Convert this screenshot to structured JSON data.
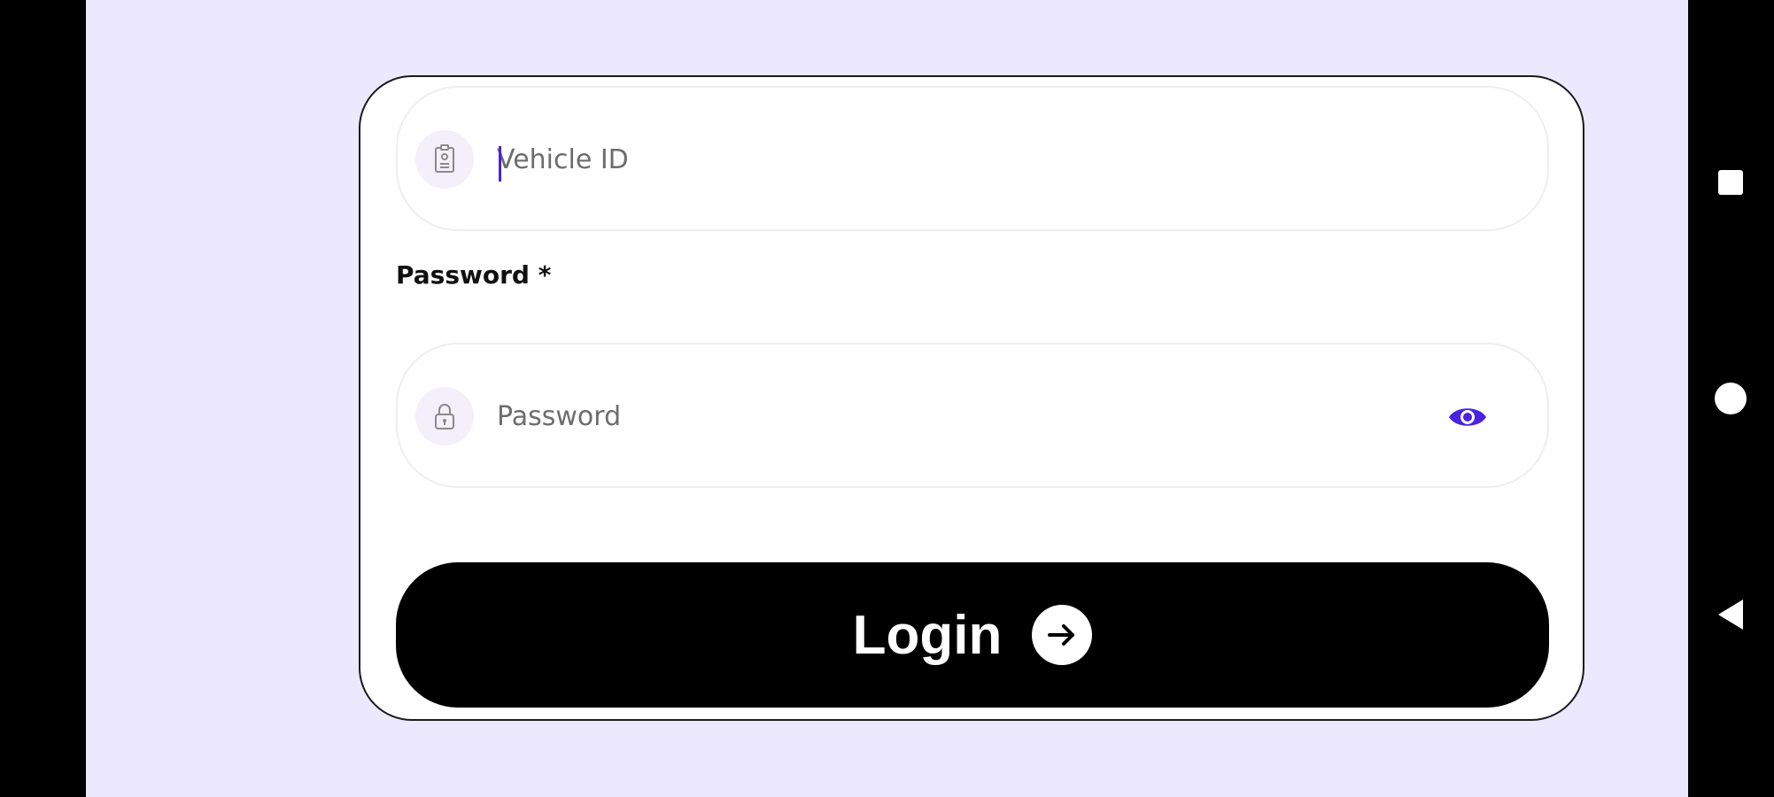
{
  "form": {
    "vehicle_id": {
      "placeholder": "Vehicle ID",
      "value": "",
      "icon": "id-badge-icon"
    },
    "password": {
      "label": "Password *",
      "placeholder": "Password",
      "value": "",
      "icon": "lock-icon",
      "toggle_icon": "eye-icon"
    },
    "login_button": {
      "label": "Login",
      "icon": "arrow-right-circle-icon"
    }
  },
  "system_nav": {
    "items": [
      "recents-square-icon",
      "home-circle-icon",
      "back-triangle-icon"
    ]
  },
  "colors": {
    "background": "#ECE8FD",
    "accent": "#4A22E0",
    "button": "#000000",
    "card": "#FFFFFF"
  }
}
